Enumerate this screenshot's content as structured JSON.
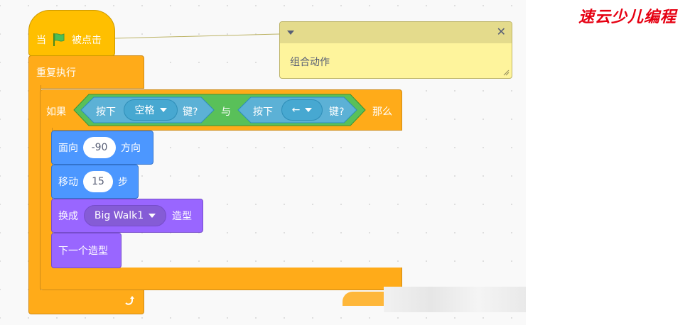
{
  "script": {
    "hat": {
      "prefix": "当",
      "suffix": "被点击",
      "flag_icon": "green-flag-icon"
    },
    "forever": {
      "label": "重复执行",
      "arrow_icon": "loop-arrow-icon"
    },
    "if_block": {
      "if_label": "如果",
      "then_label": "那么",
      "condition": {
        "operator": "与",
        "left": {
          "prefix": "按下",
          "key": "空格",
          "suffix": "键?"
        },
        "right": {
          "prefix": "按下",
          "key": "←",
          "suffix": "键?"
        }
      }
    },
    "point_direction": {
      "prefix": "面向",
      "value": "-90",
      "suffix": "方向"
    },
    "move_steps": {
      "prefix": "移动",
      "value": "15",
      "suffix": "步"
    },
    "switch_costume": {
      "prefix": "换成",
      "costume": "Big Walk1",
      "suffix": "造型"
    },
    "next_costume": {
      "label": "下一个造型"
    }
  },
  "comment": {
    "text": "组合动作",
    "collapse_icon": "collapse-caret-icon",
    "close_icon": "close-icon"
  },
  "watermark": {
    "text": "速云少儿编程"
  },
  "colors": {
    "events": "#ffbf00",
    "control": "#ffab19",
    "motion": "#4c97ff",
    "looks": "#9966ff",
    "sensing": "#5cb1d6",
    "operators": "#59c059",
    "comment": "#fef49c",
    "watermark": "#e60012"
  }
}
